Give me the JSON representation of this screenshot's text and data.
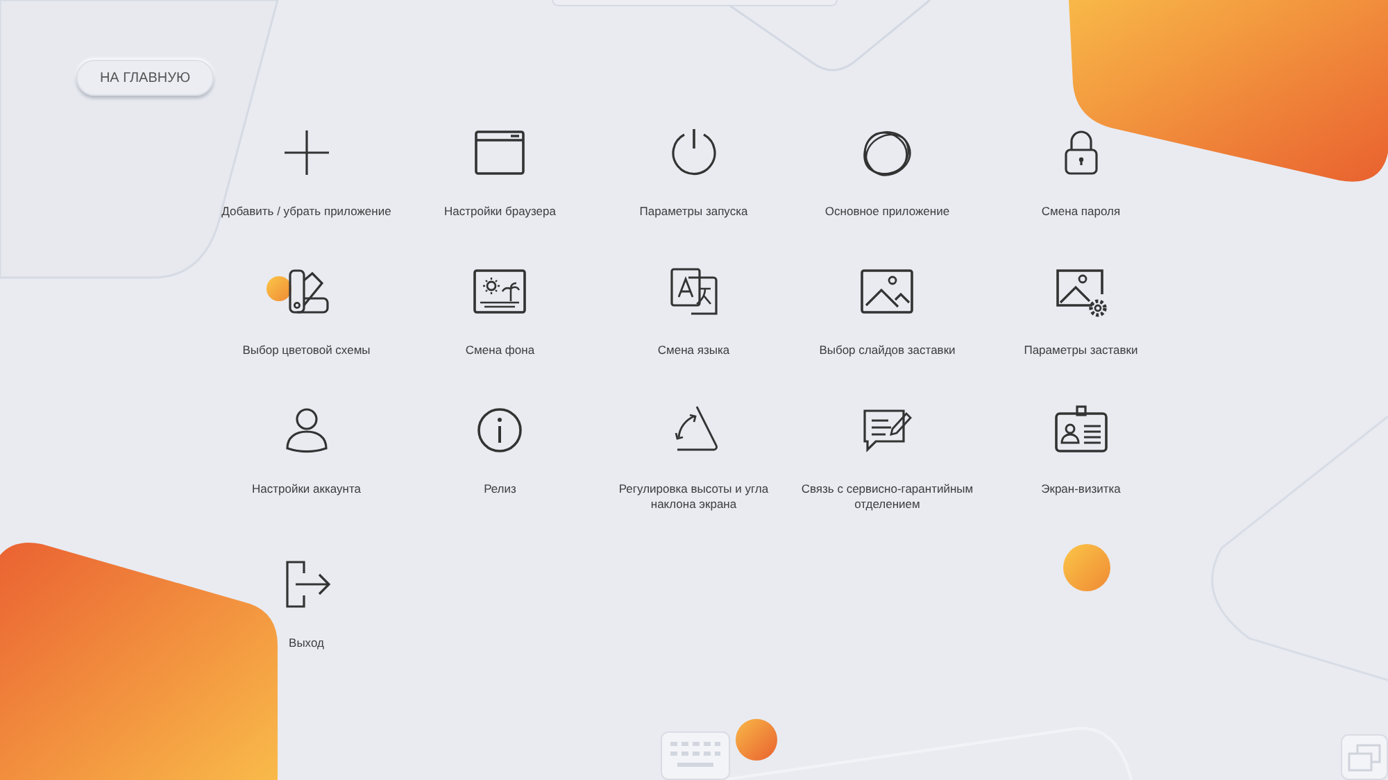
{
  "home_button": {
    "label": "НА ГЛАВНУЮ"
  },
  "items": [
    {
      "label": "Добавить / убрать приложение",
      "kind": "plus"
    },
    {
      "label": "Настройки браузера",
      "kind": "browser"
    },
    {
      "label": "Параметры запуска",
      "kind": "power"
    },
    {
      "label": "Основное приложение",
      "kind": "blob"
    },
    {
      "label": "Смена пароля",
      "kind": "lock"
    },
    {
      "label": "Выбор цветовой схемы",
      "kind": "palette"
    },
    {
      "label": "Смена фона",
      "kind": "beach"
    },
    {
      "label": "Смена языка",
      "kind": "translate"
    },
    {
      "label": "Выбор слайдов заставки",
      "kind": "image"
    },
    {
      "label": "Параметры заставки",
      "kind": "image-gear"
    },
    {
      "label": "Настройки аккаунта",
      "kind": "user"
    },
    {
      "label": "Релиз",
      "kind": "info"
    },
    {
      "label": "Регулировка высоты и угла наклона экрана",
      "kind": "tilt"
    },
    {
      "label": "Связь с сервисно-гарантийным отделением",
      "kind": "chat"
    },
    {
      "label": "Экран-визитка",
      "kind": "badge"
    },
    {
      "label": "Выход",
      "kind": "exit"
    }
  ]
}
